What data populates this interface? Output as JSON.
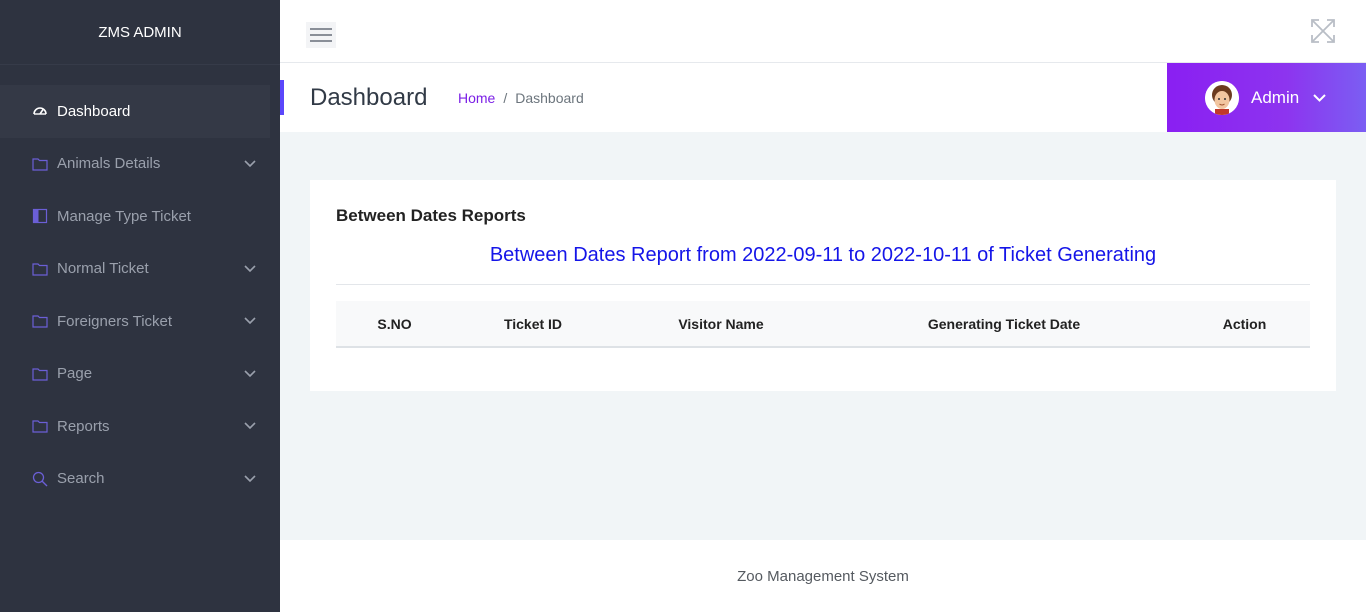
{
  "sidebar": {
    "brand": "ZMS ADMIN",
    "items": [
      {
        "label": "Dashboard",
        "icon": "dashboard-gauge-icon",
        "active": true,
        "has_submenu": false
      },
      {
        "label": "Animals Details",
        "icon": "folder-icon",
        "active": false,
        "has_submenu": true
      },
      {
        "label": "Manage Type Ticket",
        "icon": "book-icon",
        "active": false,
        "has_submenu": false
      },
      {
        "label": "Normal Ticket",
        "icon": "folder-icon",
        "active": false,
        "has_submenu": true
      },
      {
        "label": "Foreigners Ticket",
        "icon": "folder-icon",
        "active": false,
        "has_submenu": true
      },
      {
        "label": "Page",
        "icon": "folder-icon",
        "active": false,
        "has_submenu": true
      },
      {
        "label": "Reports",
        "icon": "folder-icon",
        "active": false,
        "has_submenu": true
      },
      {
        "label": "Search",
        "icon": "search-icon",
        "active": false,
        "has_submenu": true
      }
    ]
  },
  "header": {
    "page_title": "Dashboard",
    "breadcrumb": {
      "home": "Home",
      "separator": "/",
      "current": "Dashboard"
    },
    "user": {
      "name": "Admin"
    }
  },
  "card": {
    "title": "Between Dates Reports",
    "report_heading": "Between Dates Report from 2022-09-11 to 2022-10-11 of Ticket Generating",
    "table": {
      "columns": [
        "S.NO",
        "Ticket ID",
        "Visitor Name",
        "Generating Ticket Date",
        "Action"
      ],
      "rows": []
    }
  },
  "footer": {
    "text": "Zoo Management System"
  },
  "colors": {
    "sidebar_bg": "#2e3340",
    "accent_purple": "#8a1ff2",
    "link_purple": "#7b1fe6",
    "report_heading_blue": "#1515e8",
    "page_bg": "#f1f5f7"
  }
}
